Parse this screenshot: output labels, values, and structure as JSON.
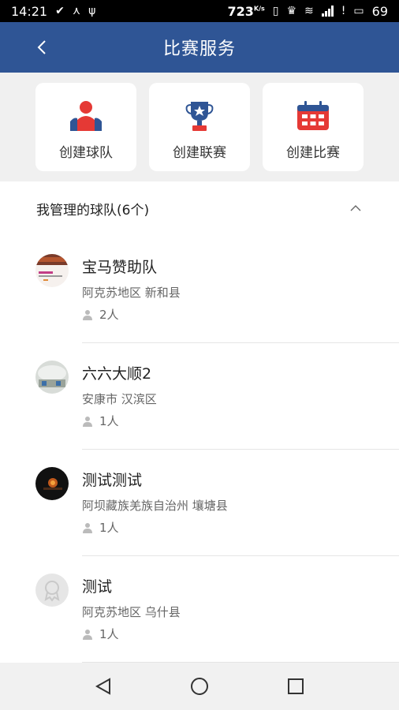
{
  "status_bar": {
    "time": "14:21",
    "net_speed": "723",
    "net_unit": "K/s",
    "battery": "69"
  },
  "header": {
    "title": "比赛服务",
    "back_icon": "back-chevron-icon"
  },
  "actions": [
    {
      "label": "创建球队",
      "icon": "team-icon"
    },
    {
      "label": "创建联赛",
      "icon": "trophy-icon"
    },
    {
      "label": "创建比赛",
      "icon": "calendar-icon"
    }
  ],
  "teams_section": {
    "title": "我管理的球队(6个)",
    "collapse_icon": "chevron-up-icon",
    "teams": [
      {
        "name": "宝马赞助队",
        "location": "阿克苏地区 新和县",
        "members": "2人"
      },
      {
        "name": "六六大顺2",
        "location": "安康市 汉滨区",
        "members": "1人"
      },
      {
        "name": "测试测试",
        "location": "阿坝藏族羌族自治州 壤塘县",
        "members": "1人"
      },
      {
        "name": "测试",
        "location": "阿克苏地区 乌什县",
        "members": "1人"
      }
    ]
  },
  "colors": {
    "header": "#2f5595",
    "accent_red": "#e53935",
    "icon_blue": "#2f5595"
  }
}
